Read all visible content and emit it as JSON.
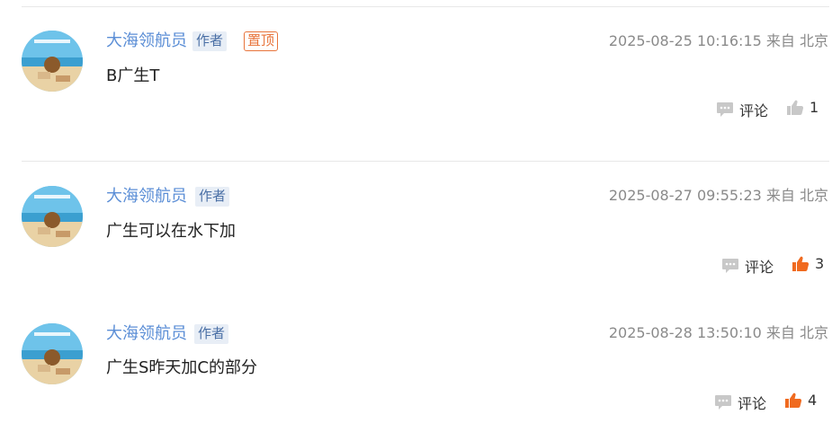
{
  "comments": [
    {
      "author": "大海领航员",
      "author_badge": "作者",
      "pinned_badge": "置顶",
      "time": "2025-08-25 10:16:15",
      "location": "来自 北京",
      "text": "B广生T",
      "comment_label": "评论",
      "likes": "1",
      "liked": false
    },
    {
      "author": "大海领航员",
      "author_badge": "作者",
      "time": "2025-08-27 09:55:23",
      "location": "来自 北京",
      "text": "广生可以在水下加",
      "comment_label": "评论",
      "likes": "3",
      "liked": true
    },
    {
      "author": "大海领航员",
      "author_badge": "作者",
      "time": "2025-08-28 13:50:10",
      "location": "来自 北京",
      "text": "广生S昨天加C的部分",
      "comment_label": "评论",
      "likes": "4",
      "liked": true
    }
  ],
  "colors": {
    "author": "#5b8ed6",
    "liked": "#f06a1f",
    "unliked": "#c8c8c8",
    "pinned": "#e8743b"
  },
  "icons": {
    "comment": "speech-bubble-icon",
    "like": "thumbs-up-icon"
  }
}
